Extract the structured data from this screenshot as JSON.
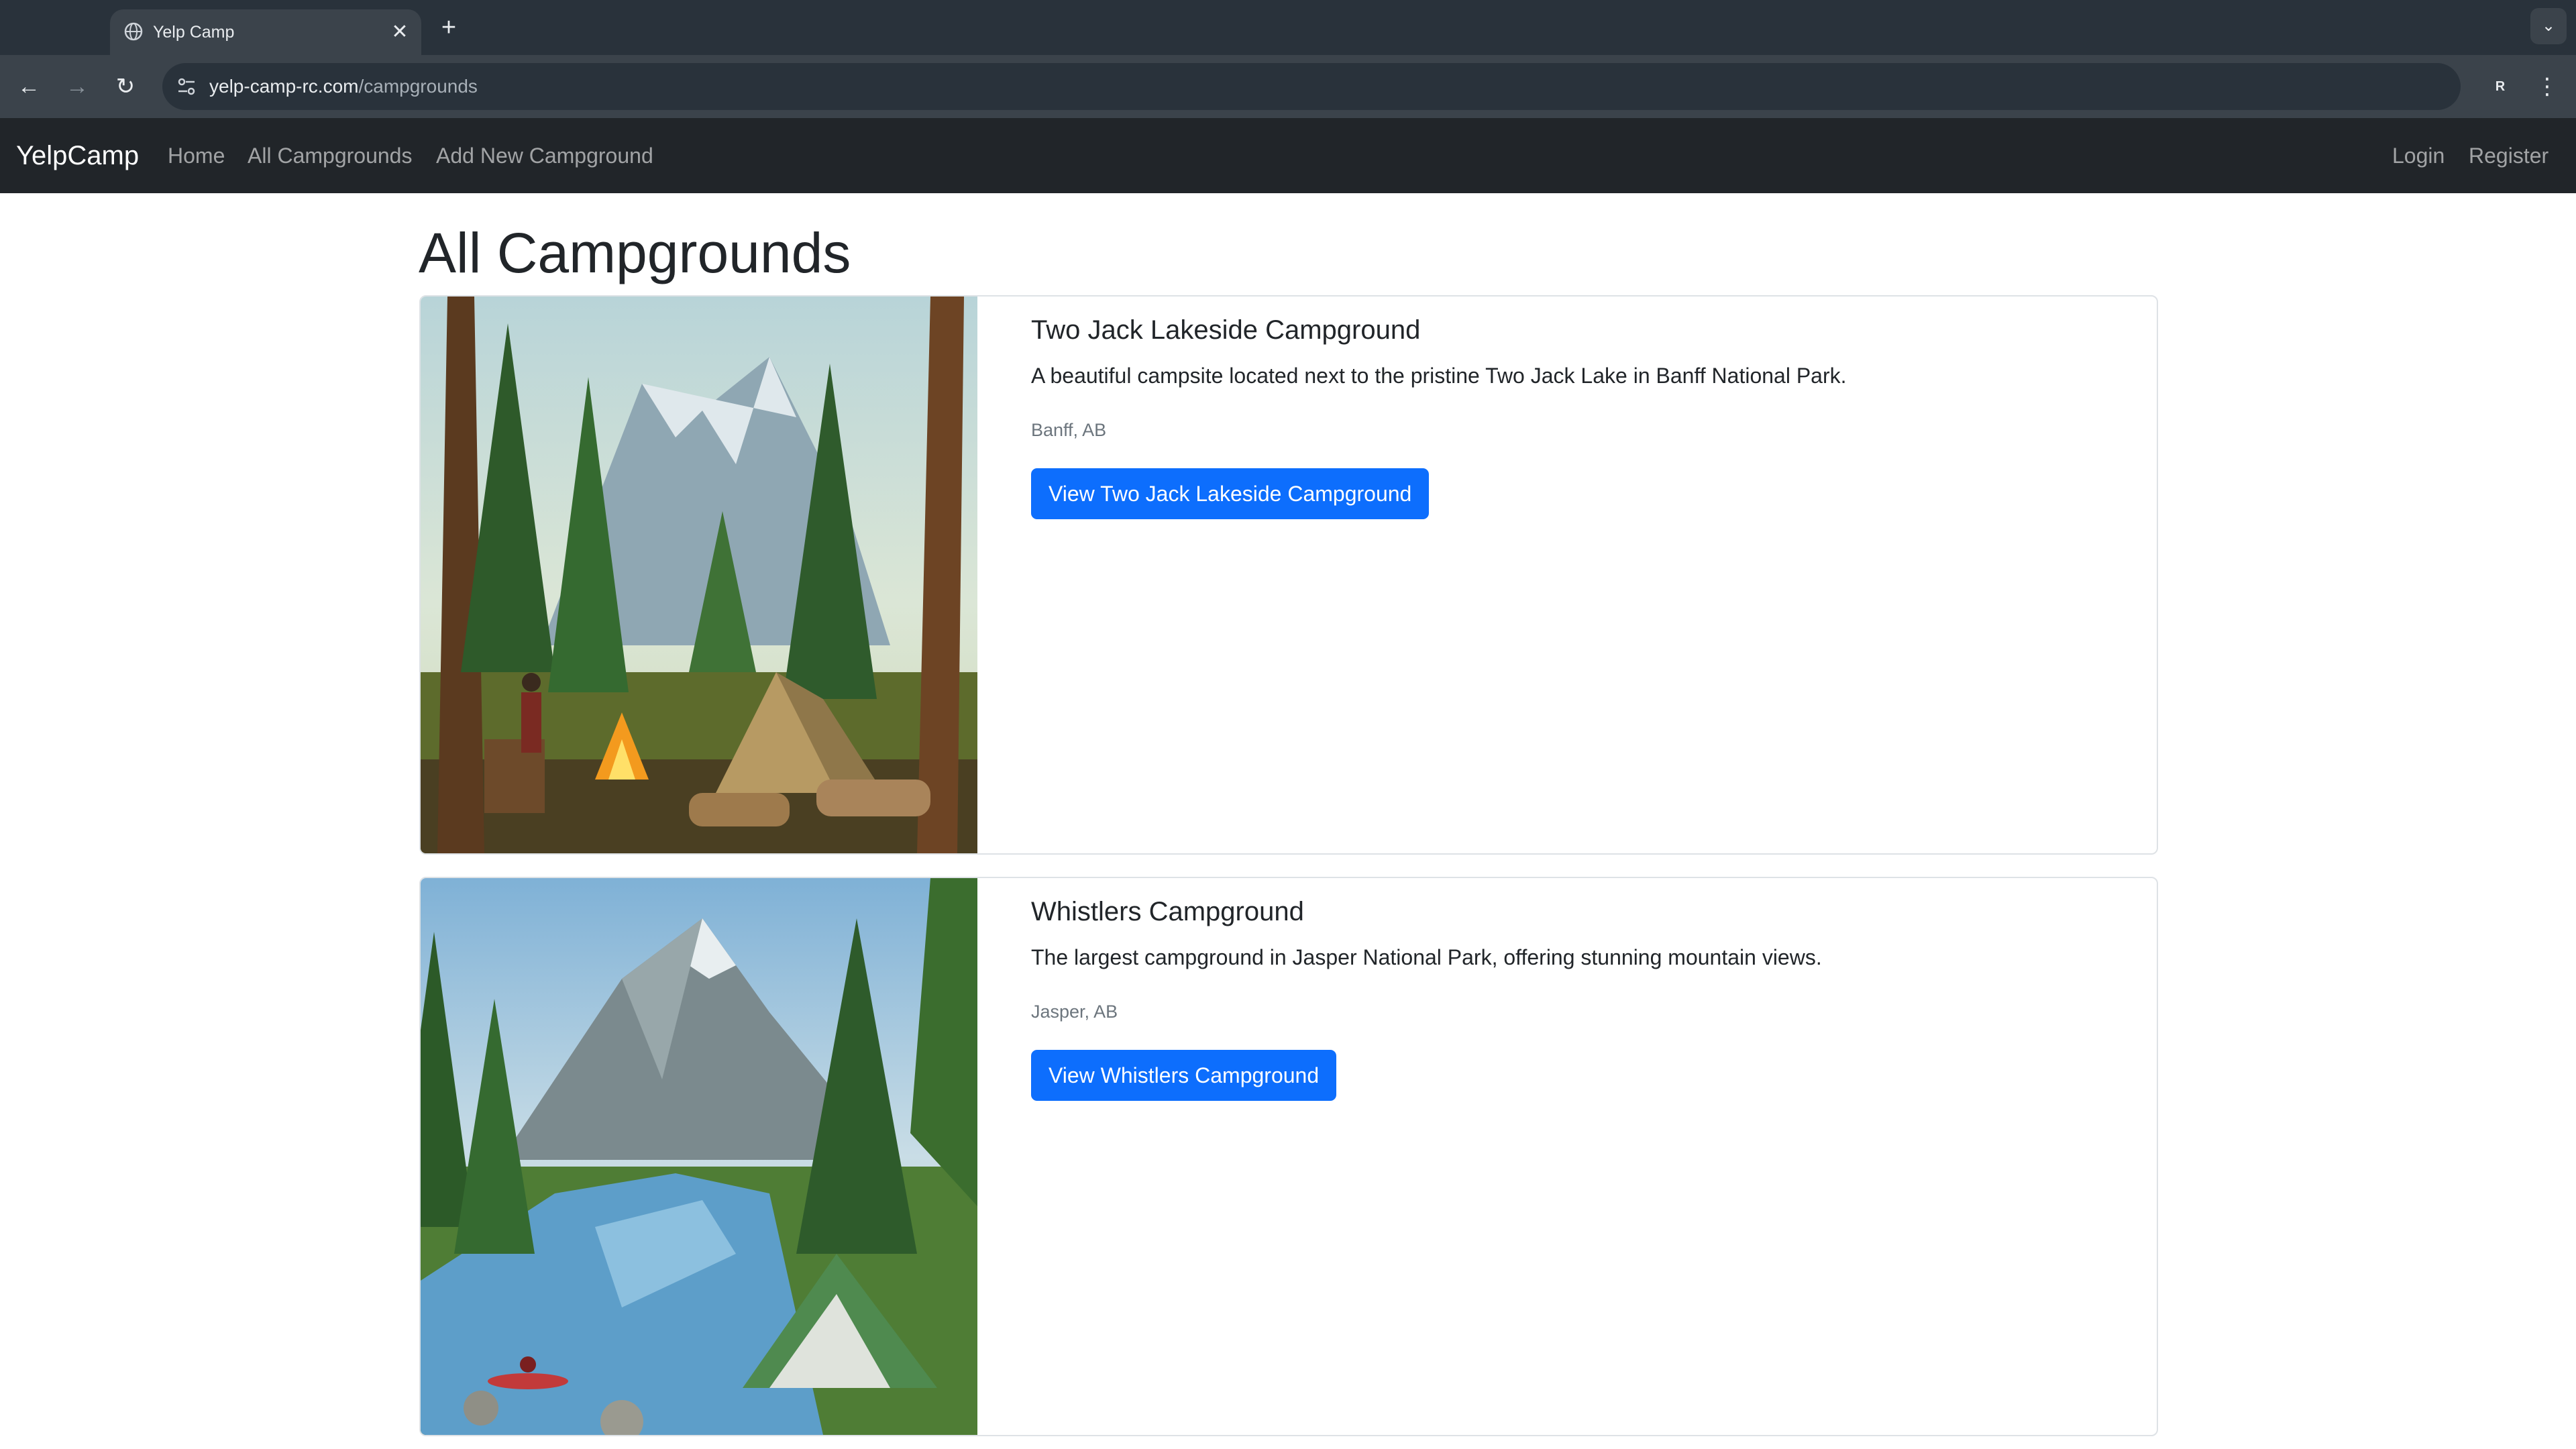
{
  "browser": {
    "tab_title": "Yelp Camp",
    "url_domain": "yelp-camp-rc.com",
    "url_path": "/campgrounds",
    "profile_initial": "R",
    "icons": {
      "back": "←",
      "forward": "→",
      "reload": "↻",
      "star": "☆",
      "menu": "⋮",
      "close": "✕",
      "new_tab": "+",
      "dropdown": "⌄"
    }
  },
  "navbar": {
    "brand": "YelpCamp",
    "links": [
      "Home",
      "All Campgrounds",
      "Add New Campground"
    ],
    "auth_links": [
      "Login",
      "Register"
    ]
  },
  "page": {
    "title": "All Campgrounds"
  },
  "campgrounds": [
    {
      "title": "Two Jack Lakeside Campground",
      "description": "A beautiful campsite located next to the pristine Two Jack Lake in Banff National Park.",
      "location": "Banff, AB",
      "button_label": "View Two Jack Lakeside Campground"
    },
    {
      "title": "Whistlers Campground",
      "description": "The largest campground in Jasper National Park, offering stunning mountain views.",
      "location": "Jasper, AB",
      "button_label": "View Whistlers Campground"
    }
  ],
  "colors": {
    "primary": "#0d6efd",
    "navbar_bg": "#212529",
    "chrome_dark": "#29323b",
    "chrome_toolbar": "#3b434b"
  }
}
